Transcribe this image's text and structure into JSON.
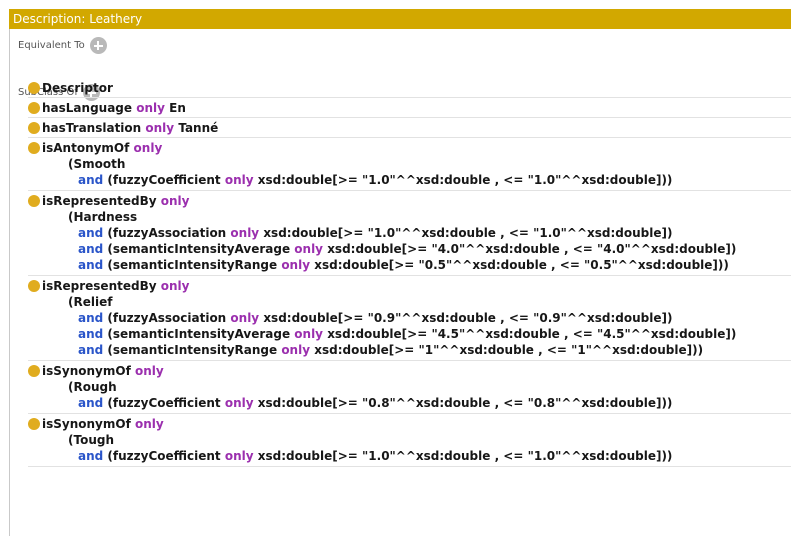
{
  "title": "Description: Leathery",
  "sections": {
    "equivalent_to": "Equivalent To",
    "subclass_of": "SubClass Of"
  },
  "axioms": [
    {
      "lines": [
        [
          "Descriptor"
        ]
      ]
    },
    {
      "lines": [
        [
          "hasLanguage",
          "only",
          "En"
        ]
      ]
    },
    {
      "lines": [
        [
          "hasTranslation",
          "only",
          "Tanné"
        ]
      ]
    },
    {
      "prop": "isAntonymOf",
      "kw": "only",
      "cls": "(Smooth",
      "ands": [
        [
          "and",
          " (fuzzyCoefficient ",
          "only",
          " xsd:double[>= \"1.0\"^^xsd:double , <= \"1.0\"^^xsd:double]))"
        ]
      ]
    },
    {
      "prop": "isRepresentedBy",
      "kw": "only",
      "cls": "(Hardness",
      "ands": [
        [
          "and",
          " (fuzzyAssociation ",
          "only",
          " xsd:double[>= \"1.0\"^^xsd:double , <= \"1.0\"^^xsd:double])"
        ],
        [
          "and",
          " (semanticIntensityAverage ",
          "only",
          " xsd:double[>= \"4.0\"^^xsd:double , <= \"4.0\"^^xsd:double])"
        ],
        [
          "and",
          " (semanticIntensityRange ",
          "only",
          " xsd:double[>= \"0.5\"^^xsd:double , <= \"0.5\"^^xsd:double]))"
        ]
      ]
    },
    {
      "prop": "isRepresentedBy",
      "kw": "only",
      "cls": "(Relief",
      "ands": [
        [
          "and",
          " (fuzzyAssociation ",
          "only",
          " xsd:double[>= \"0.9\"^^xsd:double , <= \"0.9\"^^xsd:double])"
        ],
        [
          "and",
          " (semanticIntensityAverage ",
          "only",
          " xsd:double[>= \"4.5\"^^xsd:double , <= \"4.5\"^^xsd:double])"
        ],
        [
          "and",
          " (semanticIntensityRange ",
          "only",
          " xsd:double[>= \"1\"^^xsd:double , <= \"1\"^^xsd:double]))"
        ]
      ]
    },
    {
      "prop": "isSynonymOf",
      "kw": "only",
      "cls": "(Rough",
      "ands": [
        [
          "and",
          " (fuzzyCoefficient ",
          "only",
          " xsd:double[>= \"0.8\"^^xsd:double , <= \"0.8\"^^xsd:double]))"
        ]
      ]
    },
    {
      "prop": "isSynonymOf",
      "kw": "only",
      "cls": "(Tough",
      "ands": [
        [
          "and",
          " (fuzzyCoefficient ",
          "only",
          " xsd:double[>= \"1.0\"^^xsd:double , <= \"1.0\"^^xsd:double]))"
        ]
      ]
    }
  ]
}
